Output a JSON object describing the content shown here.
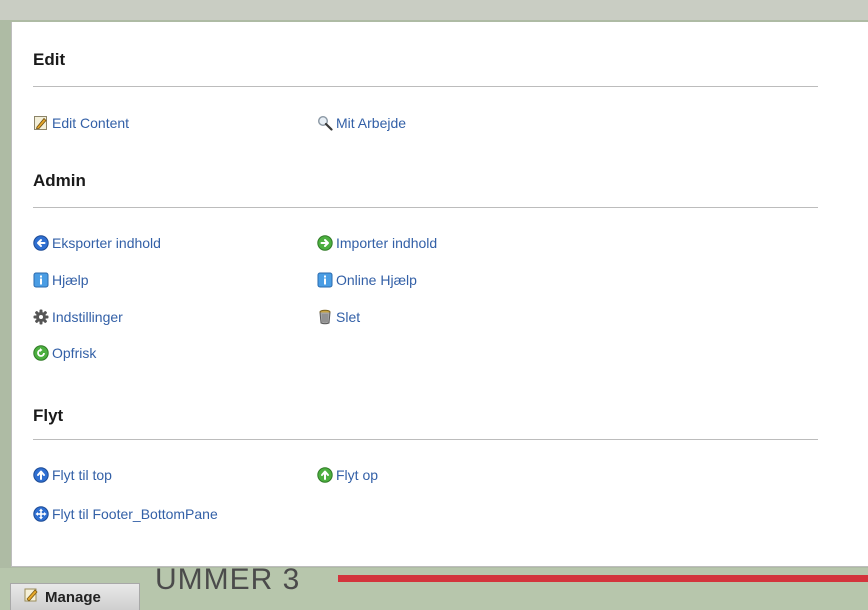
{
  "backdrop": {
    "heading_fragment": "UMMER 3"
  },
  "manage_tab": {
    "label": "Manage",
    "icon": "pencil-icon"
  },
  "sections": {
    "edit": {
      "title": "Edit",
      "items": [
        {
          "label": "Edit Content",
          "icon": "edit-document-icon"
        },
        {
          "label": "Mit Arbejde",
          "icon": "magnifier-icon"
        }
      ]
    },
    "admin": {
      "title": "Admin",
      "items": [
        {
          "label": "Eksporter indhold",
          "icon": "export-arrow-icon"
        },
        {
          "label": "Importer indhold",
          "icon": "import-arrow-icon"
        },
        {
          "label": "Hjælp",
          "icon": "help-icon"
        },
        {
          "label": "Online Hjælp",
          "icon": "online-help-icon"
        },
        {
          "label": "Indstillinger",
          "icon": "gear-icon"
        },
        {
          "label": "Slet",
          "icon": "trash-icon"
        },
        {
          "label": "Opfrisk",
          "icon": "refresh-icon"
        }
      ]
    },
    "flyt": {
      "title": "Flyt",
      "items": [
        {
          "label": "Flyt til top",
          "icon": "arrow-up-icon"
        },
        {
          "label": "Flyt op",
          "icon": "arrow-up-green-icon"
        },
        {
          "label": "Flyt til Footer_BottomPane",
          "icon": "move-icon"
        }
      ]
    }
  },
  "colors": {
    "link": "#3360a7",
    "accent_red": "#d3343c"
  }
}
